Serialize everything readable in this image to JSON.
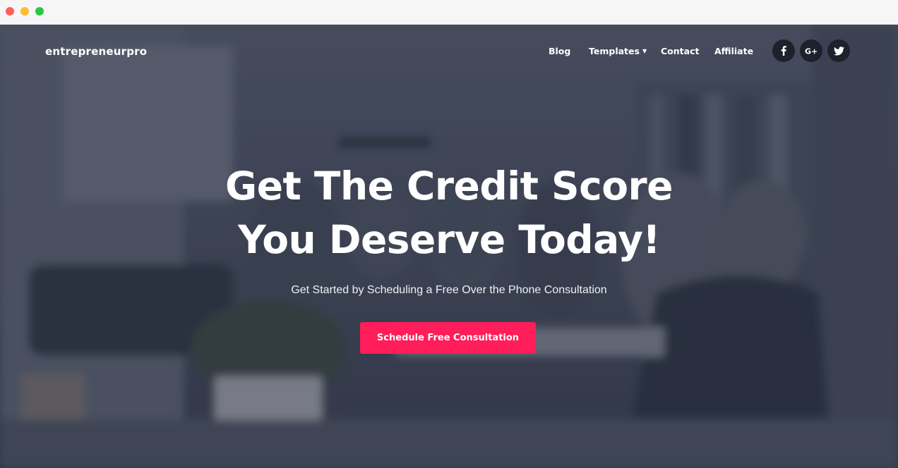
{
  "window": {
    "controls": [
      "close",
      "minimize",
      "zoom"
    ]
  },
  "header": {
    "brand": "entrepreneurpro",
    "nav": [
      {
        "label": "Blog"
      },
      {
        "label": "Templates",
        "has_dropdown": true
      },
      {
        "label": "Contact"
      },
      {
        "label": "Affiliate"
      }
    ],
    "social": [
      {
        "icon": "facebook-icon"
      },
      {
        "icon": "google-plus-icon"
      },
      {
        "icon": "twitter-icon"
      }
    ]
  },
  "hero": {
    "headline_line1": "Get The Credit Score",
    "headline_line2": "You Deserve Today!",
    "subtitle": "Get Started by Scheduling a Free Over the Phone Consultation",
    "cta_label": "Schedule Free Consultation"
  },
  "colors": {
    "accent": "#ff1d5a",
    "overlay": "#282e3e",
    "social_bg": "#1c212b"
  }
}
